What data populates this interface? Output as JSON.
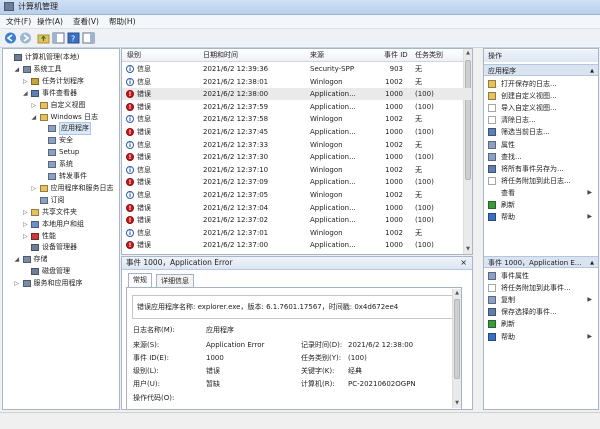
{
  "window": {
    "title": "计算机管理"
  },
  "menu": [
    "文件(F)",
    "操作(A)",
    "查看(V)",
    "帮助(H)"
  ],
  "tree": [
    {
      "label": "计算机管理(本地)",
      "depth": 0,
      "expander": "",
      "icon": "computer-icon",
      "color": "#6f7f99"
    },
    {
      "label": "系统工具",
      "depth": 1,
      "expander": "◢",
      "icon": "tools-icon",
      "color": "#7a8aa3"
    },
    {
      "label": "任务计划程序",
      "depth": 2,
      "expander": "▷",
      "icon": "clock-icon",
      "color": "#c9a23a"
    },
    {
      "label": "事件查看器",
      "depth": 2,
      "expander": "◢",
      "icon": "event-viewer-icon",
      "color": "#5f7fae"
    },
    {
      "label": "自定义视图",
      "depth": 3,
      "expander": "▷",
      "icon": "folder-icon",
      "color": "#e5c25f"
    },
    {
      "label": "Windows 日志",
      "depth": 3,
      "expander": "◢",
      "icon": "folder-icon",
      "color": "#e5c25f"
    },
    {
      "label": "应用程序",
      "depth": 4,
      "expander": "",
      "icon": "log-icon",
      "color": "#8aa1c4",
      "selected": true
    },
    {
      "label": "安全",
      "depth": 4,
      "expander": "",
      "icon": "log-icon",
      "color": "#8aa1c4"
    },
    {
      "label": "Setup",
      "depth": 4,
      "expander": "",
      "icon": "log-icon",
      "color": "#8aa1c4"
    },
    {
      "label": "系统",
      "depth": 4,
      "expander": "",
      "icon": "log-icon",
      "color": "#8aa1c4"
    },
    {
      "label": "转发事件",
      "depth": 4,
      "expander": "",
      "icon": "log-icon",
      "color": "#8aa1c4"
    },
    {
      "label": "应用程序和服务日志",
      "depth": 3,
      "expander": "▷",
      "icon": "folder-icon",
      "color": "#e5c25f"
    },
    {
      "label": "订阅",
      "depth": 3,
      "expander": "",
      "icon": "subscription-icon",
      "color": "#8aa1c4"
    },
    {
      "label": "共享文件夹",
      "depth": 2,
      "expander": "▷",
      "icon": "shared-folder-icon",
      "color": "#e5c25f"
    },
    {
      "label": "本地用户和组",
      "depth": 2,
      "expander": "▷",
      "icon": "users-icon",
      "color": "#6b8fc7"
    },
    {
      "label": "性能",
      "depth": 2,
      "expander": "▷",
      "icon": "performance-icon",
      "color": "#c83a3a"
    },
    {
      "label": "设备管理器",
      "depth": 2,
      "expander": "",
      "icon": "device-manager-icon",
      "color": "#6f7f99"
    },
    {
      "label": "存储",
      "depth": 1,
      "expander": "◢",
      "icon": "storage-icon",
      "color": "#7a8aa3"
    },
    {
      "label": "磁盘管理",
      "depth": 2,
      "expander": "",
      "icon": "disk-icon",
      "color": "#6f7f99"
    },
    {
      "label": "服务和应用程序",
      "depth": 1,
      "expander": "▷",
      "icon": "services-icon",
      "color": "#7a8aa3"
    }
  ],
  "table": {
    "columns": [
      "级别",
      "日期和时间",
      "来源",
      "事件 ID",
      "任务类别"
    ],
    "rows": [
      {
        "level": "信息",
        "type": "info",
        "time": "2021/6/2 12:39:36",
        "source": "Security-SPP",
        "id": "903",
        "category": "无"
      },
      {
        "level": "信息",
        "type": "info",
        "time": "2021/6/2 12:38:01",
        "source": "Winlogon",
        "id": "1002",
        "category": "无"
      },
      {
        "level": "错误",
        "type": "error",
        "time": "2021/6/2 12:38:00",
        "source": "Application...",
        "id": "1000",
        "category": "(100)",
        "selected": true
      },
      {
        "level": "错误",
        "type": "error",
        "time": "2021/6/2 12:37:59",
        "source": "Application...",
        "id": "1000",
        "category": "(100)"
      },
      {
        "level": "信息",
        "type": "info",
        "time": "2021/6/2 12:37:58",
        "source": "Winlogon",
        "id": "1002",
        "category": "无"
      },
      {
        "level": "错误",
        "type": "error",
        "time": "2021/6/2 12:37:45",
        "source": "Application...",
        "id": "1000",
        "category": "(100)"
      },
      {
        "level": "信息",
        "type": "info",
        "time": "2021/6/2 12:37:33",
        "source": "Winlogon",
        "id": "1002",
        "category": "无"
      },
      {
        "level": "错误",
        "type": "error",
        "time": "2021/6/2 12:37:30",
        "source": "Application...",
        "id": "1000",
        "category": "(100)"
      },
      {
        "level": "信息",
        "type": "info",
        "time": "2021/6/2 12:37:10",
        "source": "Winlogon",
        "id": "1002",
        "category": "无"
      },
      {
        "level": "错误",
        "type": "error",
        "time": "2021/6/2 12:37:09",
        "source": "Application...",
        "id": "1000",
        "category": "(100)"
      },
      {
        "level": "信息",
        "type": "info",
        "time": "2021/6/2 12:37:05",
        "source": "Winlogon",
        "id": "1002",
        "category": "无"
      },
      {
        "level": "错误",
        "type": "error",
        "time": "2021/6/2 12:37:04",
        "source": "Application...",
        "id": "1000",
        "category": "(100)"
      },
      {
        "level": "错误",
        "type": "error",
        "time": "2021/6/2 12:37:02",
        "source": "Application...",
        "id": "1000",
        "category": "(100)"
      },
      {
        "level": "信息",
        "type": "info",
        "time": "2021/6/2 12:37:01",
        "source": "Winlogon",
        "id": "1002",
        "category": "无"
      },
      {
        "level": "错误",
        "type": "error",
        "time": "2021/6/2 12:37:00",
        "source": "Application...",
        "id": "1000",
        "category": "(100)"
      }
    ]
  },
  "detail": {
    "header": "事件 1000，Application Error",
    "tabs": [
      "常规",
      "详细信息"
    ],
    "message": "错误应用程序名称: explorer.exe，版本: 6.1.7601.17567，时间戳: 0x4d672ee4",
    "fields": [
      {
        "label": "日志名称(M):",
        "value": "应用程序"
      },
      {
        "label": "来源(S):",
        "value": "Application Error",
        "label2": "记录时间(D):",
        "value2": "2021/6/2 12:38:00"
      },
      {
        "label": "事件 ID(E):",
        "value": "1000",
        "label2": "任务类别(Y):",
        "value2": "(100)"
      },
      {
        "label": "级别(L):",
        "value": "错误",
        "label2": "关键字(K):",
        "value2": "经典"
      },
      {
        "label": "用户(U):",
        "value": "暂缺",
        "label2": "计算机(R):",
        "value2": "PC-20210602OGPN"
      },
      {
        "label": "操作代码(O):",
        "value": ""
      }
    ]
  },
  "actions": {
    "title": "操作",
    "section1": "应用程序",
    "items1": [
      {
        "label": "打开保存的日志...",
        "icon": "open-log-icon",
        "color": "#e5c25f"
      },
      {
        "label": "创建自定义视图...",
        "icon": "create-view-icon",
        "color": "#e5c25f"
      },
      {
        "label": "导入自定义视图...",
        "icon": "import-view-icon",
        "color": "#ffffff"
      },
      {
        "label": "清除日志...",
        "icon": "clear-log-icon",
        "color": "#ffffff"
      },
      {
        "label": "筛选当前日志...",
        "icon": "filter-icon",
        "color": "#5c7fb8"
      },
      {
        "label": "属性",
        "icon": "properties-icon",
        "color": "#8aa1c4"
      },
      {
        "label": "查找...",
        "icon": "find-icon",
        "color": "#8aa1c4"
      },
      {
        "label": "将所有事件另存为...",
        "icon": "save-icon",
        "color": "#5f7fae"
      },
      {
        "label": "将任务附加到此日志...",
        "icon": "attach-task-icon",
        "color": "#ffffff"
      },
      {
        "label": "查看",
        "icon": "none",
        "color": "",
        "arrow": "▶"
      },
      {
        "label": "刷新",
        "icon": "refresh-icon",
        "color": "#3c9a3c"
      },
      {
        "label": "帮助",
        "icon": "help-icon",
        "color": "#3a6fc4",
        "arrow": "▶"
      }
    ],
    "section2": "事件 1000，Application E...",
    "items2": [
      {
        "label": "事件属性",
        "icon": "event-properties-icon",
        "color": "#8aa1c4"
      },
      {
        "label": "将任务附加到此事件...",
        "icon": "attach-task-icon",
        "color": "#ffffff"
      },
      {
        "label": "复制",
        "icon": "copy-icon",
        "color": "#8aa1c4",
        "arrow": "▶"
      },
      {
        "label": "保存选择的事件...",
        "icon": "save-icon",
        "color": "#5f7fae"
      },
      {
        "label": "刷新",
        "icon": "refresh-icon",
        "color": "#3c9a3c"
      },
      {
        "label": "帮助",
        "icon": "help-icon",
        "color": "#3a6fc4",
        "arrow": "▶"
      }
    ]
  }
}
